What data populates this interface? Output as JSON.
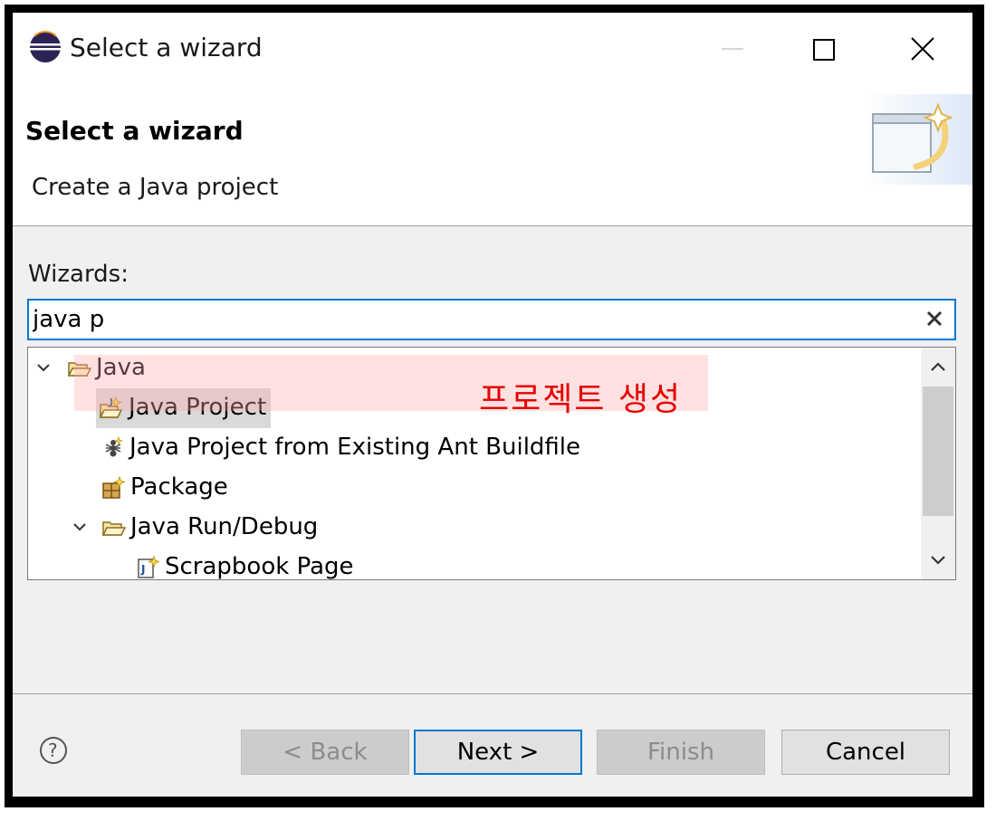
{
  "window": {
    "title": "Select a wizard"
  },
  "header": {
    "title": "Select a wizard",
    "description": "Create a Java project"
  },
  "wizards": {
    "label": "Wizards:",
    "filter_value": "java p",
    "tree": [
      {
        "label": "Java",
        "expanded": true,
        "icon": "folder-open-icon"
      },
      {
        "label": "Java Project",
        "icon": "java-project-icon",
        "selected": true
      },
      {
        "label": "Java Project from Existing Ant Buildfile",
        "icon": "ant-icon"
      },
      {
        "label": "Package",
        "icon": "package-icon"
      },
      {
        "label": "Java Run/Debug",
        "expanded": true,
        "icon": "folder-open-icon"
      },
      {
        "label": "Scrapbook Page",
        "icon": "scrapbook-icon"
      }
    ]
  },
  "annotation": {
    "text": "프로젝트 생성",
    "color": "#e60000"
  },
  "buttons": {
    "back": "< Back",
    "next": "Next >",
    "finish": "Finish",
    "cancel": "Cancel"
  },
  "colors": {
    "accent": "#0078d7",
    "selection": "#d9d9d9"
  }
}
